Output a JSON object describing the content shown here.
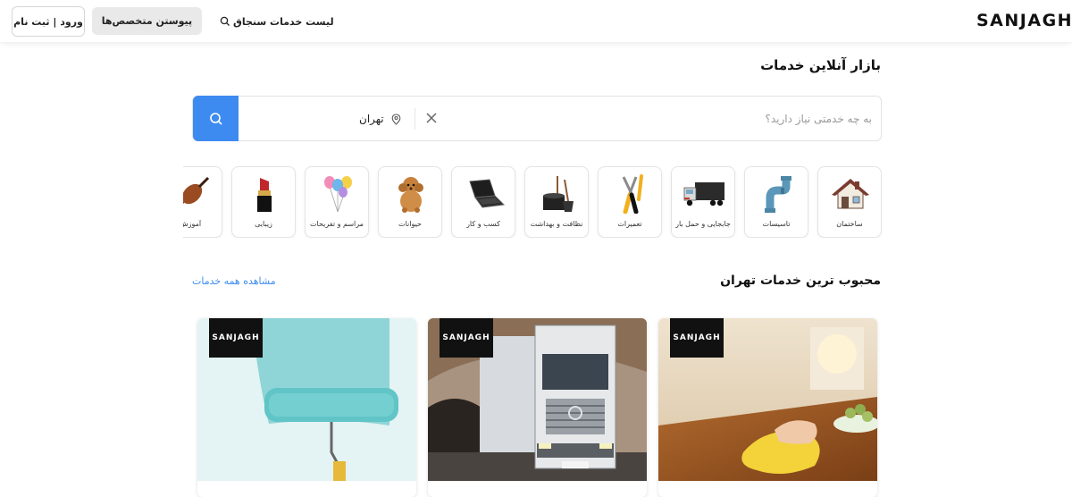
{
  "header": {
    "logo": "SANJAGH",
    "login_label": "ورود | ثبت نام",
    "join_label": "پیوستن متخصص‌ها",
    "services_list_label": "لیست خدمات سنجاق"
  },
  "main": {
    "title": "بازار آنلاین خدمات",
    "search": {
      "placeholder": "به چه خدمتی نیاز دارید؟",
      "city": "تهران"
    },
    "categories": [
      {
        "label": "ساختمان",
        "icon": "house-icon"
      },
      {
        "label": "تاسیسات",
        "icon": "pipe-icon"
      },
      {
        "label": "جابجایی و حمل بار",
        "icon": "truck-icon"
      },
      {
        "label": "تعمیرات",
        "icon": "tools-icon"
      },
      {
        "label": "نظافت و بهداشت",
        "icon": "cleaning-icon"
      },
      {
        "label": "کسب و کار",
        "icon": "laptop-icon"
      },
      {
        "label": "حیوانات",
        "icon": "dog-icon"
      },
      {
        "label": "مراسم و تفریحات",
        "icon": "balloons-icon"
      },
      {
        "label": "زیبایی",
        "icon": "lipstick-icon"
      },
      {
        "label": "آموزش",
        "icon": "violin-icon"
      }
    ],
    "popular": {
      "title": "محبوب ترین خدمات تهران",
      "see_all": "مشاهده همه خدمات",
      "cards": [
        {
          "tag": "SANJAGH",
          "image": "cleaning-photo"
        },
        {
          "tag": "SANJAGH",
          "image": "truck-photo"
        },
        {
          "tag": "SANJAGH",
          "image": "paint-roller-photo"
        }
      ]
    }
  },
  "colors": {
    "accent": "#3d8bf0",
    "tag_bg": "#111111"
  }
}
